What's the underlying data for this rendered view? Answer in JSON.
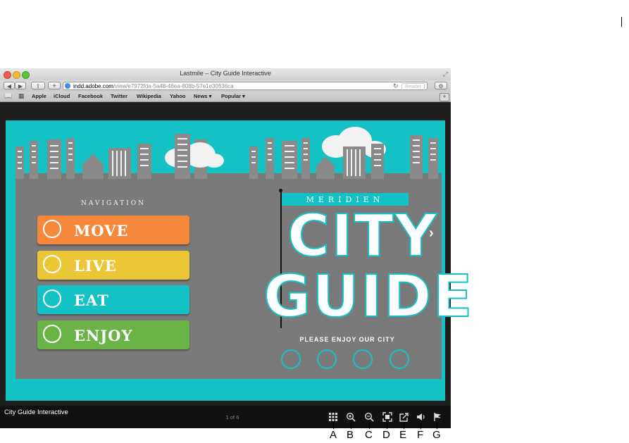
{
  "window": {
    "title": "Lastmile – City Guide Interactive",
    "url_domain": "indd.adobe.com",
    "url_path": "/view/e7972fda-5a48-46ea-808b-57e1e30536ca",
    "reader_label": "Reader"
  },
  "bookmarks": [
    "Apple",
    "iCloud",
    "Facebook",
    "Twitter",
    "Wikipedia",
    "Yahoo",
    "News ▾",
    "Popular ▾"
  ],
  "page": {
    "nav_heading": "NAVIGATION",
    "nav_items": [
      {
        "label": "MOVE",
        "color": "#f5883a"
      },
      {
        "label": "LIVE",
        "color": "#ebc637"
      },
      {
        "label": "EAT",
        "color": "#14c2c6"
      },
      {
        "label": "ENJOY",
        "color": "#6ab447"
      }
    ],
    "banner": "MERIDIEN",
    "title_line1": "CITY",
    "title_line2": "GUIDE",
    "tagline": "PLEASE ENJOY OUR CITY"
  },
  "footer": {
    "doc_title": "City Guide Interactive",
    "page_indicator": "1 of 6"
  },
  "controls": [
    {
      "letter": "A",
      "icon": "grid-icon"
    },
    {
      "letter": "B",
      "icon": "zoom-in-icon"
    },
    {
      "letter": "C",
      "icon": "zoom-out-icon"
    },
    {
      "letter": "D",
      "icon": "fullscreen-icon"
    },
    {
      "letter": "E",
      "icon": "share-icon"
    },
    {
      "letter": "F",
      "icon": "volume-icon"
    },
    {
      "letter": "G",
      "icon": "flag-icon"
    }
  ],
  "colors": {
    "teal": "#14c2c6",
    "page_gray": "#7a7a7a",
    "dark_bar": "#111111"
  }
}
